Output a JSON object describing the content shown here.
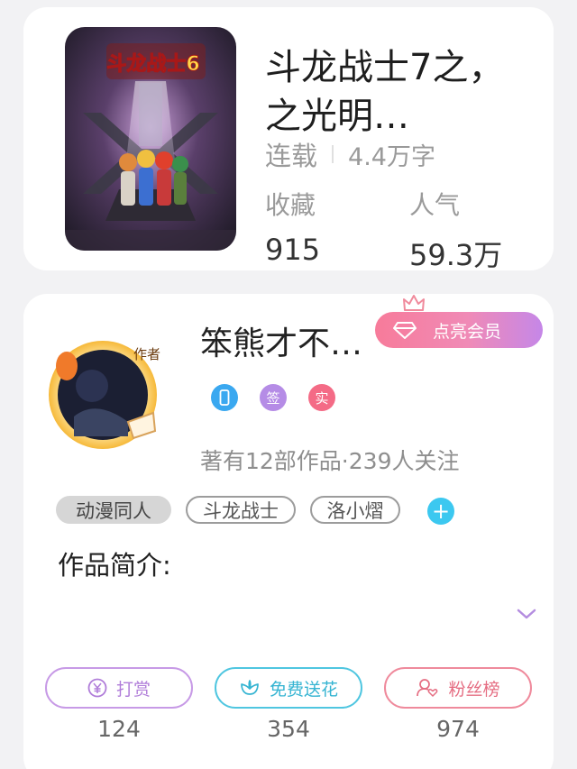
{
  "book": {
    "title": "斗龙战士7之，之光明…",
    "cover_logo_text": "斗龙战士6",
    "status": "连载",
    "word_count": "4.4万字",
    "stats": [
      {
        "label": "收藏",
        "value": "915"
      },
      {
        "label": "人气",
        "value": "59.3万"
      }
    ]
  },
  "author": {
    "name": "笨熊才不…",
    "avatar_badge_text": "作者",
    "member_button_label": "点亮会员",
    "badges": [
      {
        "icon": "phone-icon",
        "text": "",
        "color": "#3aa8f0"
      },
      {
        "icon": "sign-badge",
        "text": "签",
        "color": "#b58ce6"
      },
      {
        "icon": "verified-badge",
        "text": "实",
        "color": "#f46b86"
      }
    ],
    "works_info": "著有12部作品·239人关注"
  },
  "tags": [
    "动漫同人",
    "斗龙战士",
    "洛小熠"
  ],
  "intro": {
    "title": "作品简介:"
  },
  "actions": [
    {
      "label": "打赏",
      "count": "124",
      "icon": "yen-coin-icon",
      "color": "#c79ae6"
    },
    {
      "label": "免费送花",
      "count": "354",
      "icon": "flower-icon",
      "color": "#4fc6e0"
    },
    {
      "label": "粉丝榜",
      "count": "974",
      "icon": "fan-heart-icon",
      "color": "#ef8a9c"
    }
  ],
  "colors": {
    "background": "#f2f2f4",
    "member_gradient_start": "#f77b9a",
    "member_gradient_end": "#c587e8",
    "tag_add": "#3cc8f0"
  }
}
